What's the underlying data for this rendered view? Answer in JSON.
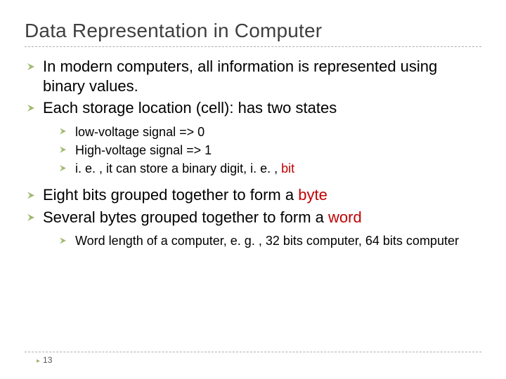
{
  "slide": {
    "title": "Data Representation in Computer",
    "page_number": "13",
    "bullets": {
      "b1": "In modern computers, all information is represented using binary values.",
      "b2": "Each storage location (cell): has two states",
      "b2_sub": {
        "s1": "low-voltage signal  => 0",
        "s2": "High-voltage signal => 1",
        "s3_a": "i. e. , it can store a binary digit, i. e. , ",
        "s3_kw": "bit"
      },
      "b3_a": "Eight bits grouped together to form a ",
      "b3_kw": "byte",
      "b4_a": "Several bytes grouped together to form a ",
      "b4_kw": "word",
      "b4_sub": {
        "s1": "Word length of a computer, e. g. , 32 bits computer, 64 bits computer"
      }
    }
  }
}
